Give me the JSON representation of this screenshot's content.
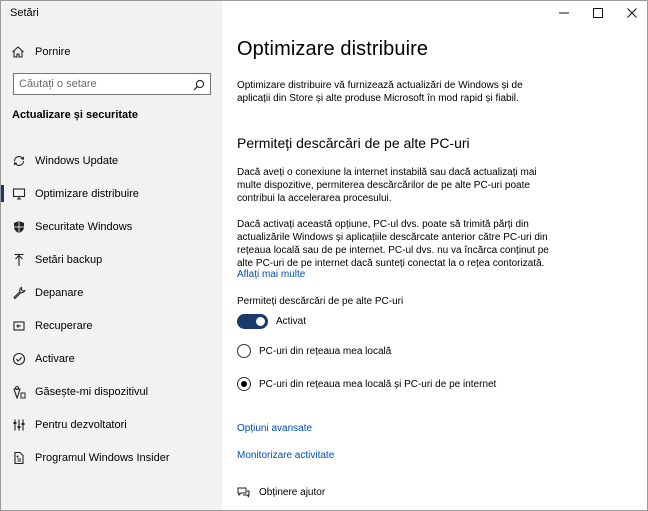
{
  "window": {
    "app_title": "Setări"
  },
  "sidebar": {
    "home_label": "Pornire",
    "search_placeholder": "Căutați o setare",
    "section_title": "Actualizare și securitate",
    "items": [
      {
        "label": "Windows Update",
        "icon": "refresh-icon",
        "selected": false
      },
      {
        "label": "Optimizare distribuire",
        "icon": "delivery-optimization-icon",
        "selected": true
      },
      {
        "label": "Securitate Windows",
        "icon": "shield-icon",
        "selected": false
      },
      {
        "label": "Setări backup",
        "icon": "upload-arrow-icon",
        "selected": false
      },
      {
        "label": "Depanare",
        "icon": "wrench-icon",
        "selected": false
      },
      {
        "label": "Recuperare",
        "icon": "recovery-icon",
        "selected": false
      },
      {
        "label": "Activare",
        "icon": "check-circle-icon",
        "selected": false
      },
      {
        "label": "Găsește-mi dispozitivul",
        "icon": "find-device-icon",
        "selected": false
      },
      {
        "label": "Pentru dezvoltatori",
        "icon": "developer-icon",
        "selected": false
      },
      {
        "label": "Programul Windows Insider",
        "icon": "insider-icon",
        "selected": false
      }
    ]
  },
  "main": {
    "title": "Optimizare distribuire",
    "intro": "Optimizare distribuire vă furnizează actualizări de Windows și de aplicații din Store și alte produse Microsoft în mod rapid și fiabil.",
    "subtitle": "Permiteți descărcări de pe alte PC-uri",
    "paragraph1": "Dacă aveți o conexiune la internet instabilă sau dacă actualizați mai multe dispozitive, permiterea descărcărilor de pe alte PC-uri poate contribui la accelerarea procesului.",
    "paragraph2": "Dacă activați această opțiune, PC-ul dvs. poate să trimită părți din actualizările Windows și aplicațiile descărcate anterior către PC-uri din rețeaua locală sau de pe internet. PC-ul dvs. nu va încărca conținut pe alte PC-uri de pe internet dacă sunteți conectat la o rețea contorizată.",
    "learn_more": "Aflați mai multe",
    "toggle_label": "Permiteți descărcări de pe alte PC-uri",
    "toggle_state": "Activat",
    "toggle_on": true,
    "radio_local": "PC-uri din rețeaua mea locală",
    "radio_internet": "PC-uri din rețeaua mea locală și PC-uri de pe internet",
    "selected_radio": "internet",
    "advanced_link": "Opțiuni avansate",
    "monitor_link": "Monitorizare activitate",
    "help_label": "Obținere ajutor"
  }
}
